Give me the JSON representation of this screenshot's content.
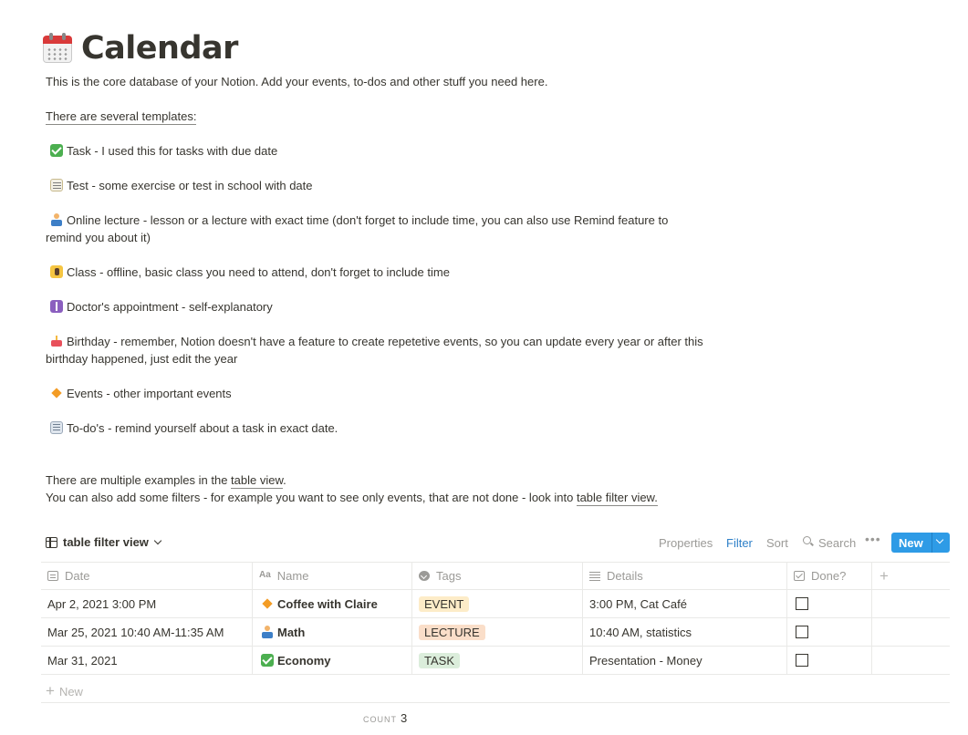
{
  "page": {
    "icon": "calendar-icon",
    "title": "Calendar",
    "intro": "This is the core database of your Notion. Add your events, to-dos and other stuff you need here.",
    "templates_heading": "There are several templates:",
    "templates": [
      {
        "icon": "check-mark-icon",
        "text": "Task - I used this for tasks with due date"
      },
      {
        "icon": "memo-icon",
        "text": "Test - some exercise or test in school with date"
      },
      {
        "icon": "teacher-icon",
        "line1": "Online lecture - lesson or a lecture with exact time (don't forget to include time, you can also use Remind feature to",
        "line2": "remind you about it)"
      },
      {
        "icon": "school-icon",
        "text": "Class - offline, basic class you need to attend, don't forget to include time"
      },
      {
        "icon": "medical-icon",
        "text": "Doctor's appointment - self-explanatory"
      },
      {
        "icon": "cake-icon",
        "line1": "Birthday - remember, Notion doesn't have a feature to create repetetive events, so you can update every year or after this",
        "line2": "birthday happened, just edit the year"
      },
      {
        "icon": "orange-diamond-icon",
        "text": "Events - other important events"
      },
      {
        "icon": "notepad-icon",
        "text": "To-do's - remind yourself about a task in exact date."
      }
    ],
    "examples_prefix": "There are multiple examples in the ",
    "examples_link": "table view",
    "examples_suffix": ".",
    "filters_prefix": "You can also add some filters - for example you want to see only events, that are not done - look into ",
    "filters_link": "table filter view."
  },
  "toolbar": {
    "view_label": "table filter view",
    "properties": "Properties",
    "filter": "Filter",
    "sort": "Sort",
    "search": "Search",
    "more": "•••",
    "new_label": "New",
    "filter_color": "#2f80c8",
    "new_color": "#2e9be6"
  },
  "table": {
    "columns": [
      "Date",
      "Name",
      "Tags",
      "Details",
      "Done?"
    ],
    "add_column": "+",
    "rows": [
      {
        "date": "Apr 2, 2021 3:00 PM",
        "name_icon": "orange-diamond-icon",
        "name": "Coffee with Claire",
        "tag": "EVENT",
        "tag_bg": "#fdecc8",
        "details": "3:00 PM, Cat Café",
        "done": false
      },
      {
        "date": "Mar 25, 2021 10:40 AM-11:35 AM",
        "name_icon": "teacher-icon",
        "name": "Math",
        "tag": "LECTURE",
        "tag_bg": "#fadec9",
        "details": "10:40 AM, statistics",
        "done": false
      },
      {
        "date": "Mar 31, 2021",
        "name_icon": "check-mark-icon",
        "name": "Economy",
        "tag": "TASK",
        "tag_bg": "#dbeddb",
        "details": "Presentation - Money",
        "done": false
      }
    ],
    "new_row": "New",
    "count_label": "COUNT",
    "count_value": "3"
  }
}
